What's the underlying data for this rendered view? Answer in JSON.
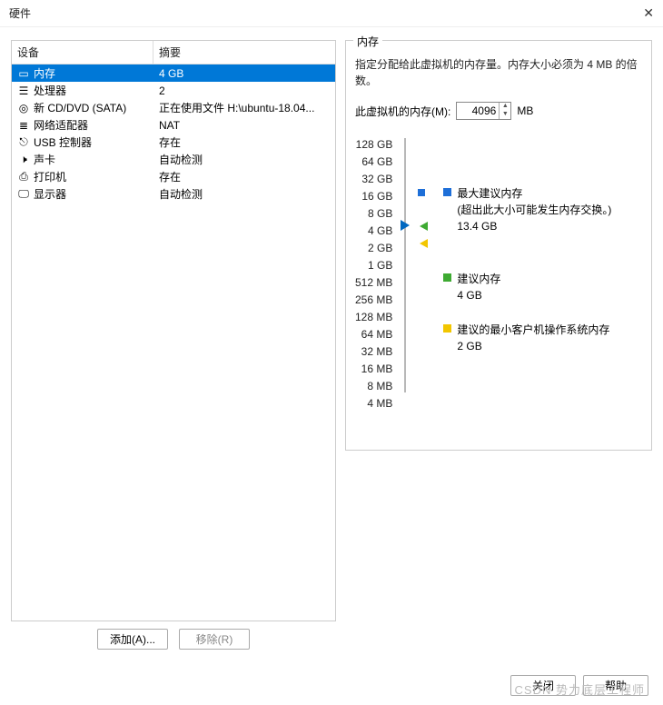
{
  "window": {
    "title": "硬件"
  },
  "headers": {
    "device": "设备",
    "summary": "摘要"
  },
  "devices": [
    {
      "name": "内存",
      "summary": "4 GB",
      "icon": "memory",
      "selected": true
    },
    {
      "name": "处理器",
      "summary": "2",
      "icon": "cpu"
    },
    {
      "name": "新 CD/DVD (SATA)",
      "summary": "正在使用文件 H:\\ubuntu-18.04...",
      "icon": "disc"
    },
    {
      "name": "网络适配器",
      "summary": "NAT",
      "icon": "nic"
    },
    {
      "name": "USB 控制器",
      "summary": "存在",
      "icon": "usb"
    },
    {
      "name": "声卡",
      "summary": "自动检测",
      "icon": "sound"
    },
    {
      "name": "打印机",
      "summary": "存在",
      "icon": "printer"
    },
    {
      "name": "显示器",
      "summary": "自动检测",
      "icon": "display"
    }
  ],
  "buttons": {
    "add": "添加(A)...",
    "remove": "移除(R)",
    "close": "关闭",
    "help": "帮助"
  },
  "memory": {
    "panel_title": "内存",
    "desc": "指定分配给此虚拟机的内存量。内存大小必须为 4 MB 的倍数。",
    "label": "此虚拟机的内存(M):",
    "value": "4096",
    "unit": "MB",
    "ticks": [
      "128 GB",
      "64 GB",
      "32 GB",
      "16 GB",
      "8 GB",
      "4 GB",
      "2 GB",
      "1 GB",
      "512 MB",
      "256 MB",
      "128 MB",
      "64 MB",
      "32 MB",
      "16 MB",
      "8 MB",
      "4 MB"
    ],
    "legend": {
      "max": {
        "title": "最大建议内存",
        "sub": "(超出此大小可能发生内存交换。)",
        "value": "13.4 GB"
      },
      "rec": {
        "title": "建议内存",
        "value": "4 GB"
      },
      "min": {
        "title": "建议的最小客户机操作系统内存",
        "value": "2 GB"
      }
    }
  },
  "watermark": "CSDN 势力底层工程师"
}
